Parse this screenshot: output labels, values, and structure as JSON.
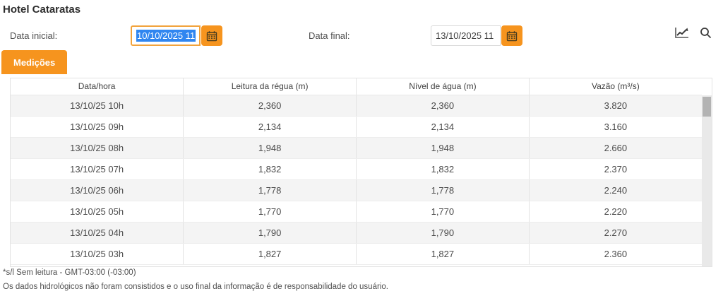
{
  "page": {
    "title": "Hotel Cataratas"
  },
  "filters": {
    "start": {
      "label": "Data inicial:",
      "value": "10/10/2025 11",
      "state": "focused-text-selected"
    },
    "end": {
      "label": "Data final:",
      "value": "13/10/2025 11"
    }
  },
  "toolbar": {
    "icons": [
      "line-chart",
      "search"
    ]
  },
  "tabs": {
    "medicoes": {
      "label": "Medições",
      "active": true
    }
  },
  "table": {
    "headers": [
      "Data/hora",
      "Leitura da régua (m)",
      "Nível de água (m)",
      "Vazão (m³/s)"
    ],
    "rows": [
      [
        "13/10/25 10h",
        "2,360",
        "2,360",
        "3.820"
      ],
      [
        "13/10/25 09h",
        "2,134",
        "2,134",
        "3.160"
      ],
      [
        "13/10/25 08h",
        "1,948",
        "1,948",
        "2.660"
      ],
      [
        "13/10/25 07h",
        "1,832",
        "1,832",
        "2.370"
      ],
      [
        "13/10/25 06h",
        "1,778",
        "1,778",
        "2.240"
      ],
      [
        "13/10/25 05h",
        "1,770",
        "1,770",
        "2.220"
      ],
      [
        "13/10/25 04h",
        "1,790",
        "1,790",
        "2.270"
      ],
      [
        "13/10/25 03h",
        "1,827",
        "1,827",
        "2.360"
      ]
    ]
  },
  "footnotes": {
    "line1": "*s/l Sem leitura - GMT-03:00 (-03:00)",
    "line2": "Os dados hidrológicos não foram consistidos e o uso final da informação é de responsabilidade do usuário."
  },
  "colors": {
    "accent_orange": "#f6941e",
    "selection_blue": "#3086f0",
    "row_alt_gray": "#f4f4f4"
  }
}
